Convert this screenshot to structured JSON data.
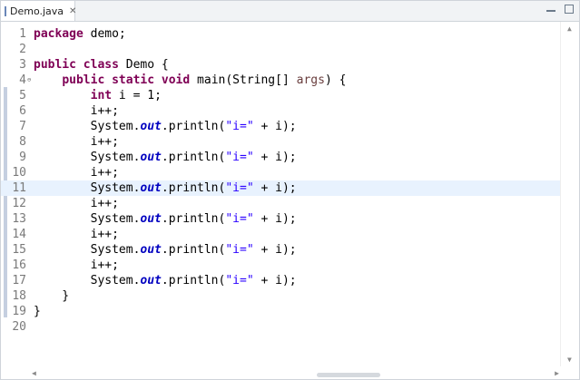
{
  "tab": {
    "label": "Demo.java",
    "close": "✕"
  },
  "editor": {
    "highlighted_line": 11,
    "lines": [
      {
        "n": "1",
        "code": [
          {
            "t": "package",
            "c": "kw"
          },
          {
            "t": " demo;"
          }
        ]
      },
      {
        "n": "2",
        "code": []
      },
      {
        "n": "3",
        "code": [
          {
            "t": "public",
            "c": "kw"
          },
          {
            "t": " "
          },
          {
            "t": "class",
            "c": "kw"
          },
          {
            "t": " Demo {"
          }
        ]
      },
      {
        "n": "4",
        "fold": "⊖",
        "code": [
          {
            "t": "    "
          },
          {
            "t": "public",
            "c": "kw"
          },
          {
            "t": " "
          },
          {
            "t": "static",
            "c": "kw"
          },
          {
            "t": " "
          },
          {
            "t": "void",
            "c": "kw"
          },
          {
            "t": " main(String[] "
          },
          {
            "t": "args",
            "c": "arg"
          },
          {
            "t": ") {"
          }
        ]
      },
      {
        "n": "5",
        "code": [
          {
            "t": "        "
          },
          {
            "t": "int",
            "c": "kw"
          },
          {
            "t": " i = 1;"
          }
        ]
      },
      {
        "n": "6",
        "code": [
          {
            "t": "        i++;"
          }
        ]
      },
      {
        "n": "7",
        "code": [
          {
            "t": "        System."
          },
          {
            "t": "out",
            "c": "fld"
          },
          {
            "t": ".println("
          },
          {
            "t": "\"i=\"",
            "c": "str"
          },
          {
            "t": " + i);"
          }
        ]
      },
      {
        "n": "8",
        "code": [
          {
            "t": "        i++;"
          }
        ]
      },
      {
        "n": "9",
        "code": [
          {
            "t": "        System."
          },
          {
            "t": "out",
            "c": "fld"
          },
          {
            "t": ".println("
          },
          {
            "t": "\"i=\"",
            "c": "str"
          },
          {
            "t": " + i);"
          }
        ]
      },
      {
        "n": "10",
        "code": [
          {
            "t": "        i++;"
          }
        ]
      },
      {
        "n": "11",
        "code": [
          {
            "t": "        System."
          },
          {
            "t": "out",
            "c": "fld"
          },
          {
            "t": ".println("
          },
          {
            "t": "\"i=\"",
            "c": "str"
          },
          {
            "t": " + i);"
          }
        ]
      },
      {
        "n": "12",
        "code": [
          {
            "t": "        i++;"
          }
        ]
      },
      {
        "n": "13",
        "code": [
          {
            "t": "        System."
          },
          {
            "t": "out",
            "c": "fld"
          },
          {
            "t": ".println("
          },
          {
            "t": "\"i=\"",
            "c": "str"
          },
          {
            "t": " + i);"
          }
        ]
      },
      {
        "n": "14",
        "code": [
          {
            "t": "        i++;"
          }
        ]
      },
      {
        "n": "15",
        "code": [
          {
            "t": "        System."
          },
          {
            "t": "out",
            "c": "fld"
          },
          {
            "t": ".println("
          },
          {
            "t": "\"i=\"",
            "c": "str"
          },
          {
            "t": " + i);"
          }
        ]
      },
      {
        "n": "16",
        "code": [
          {
            "t": "        i++;"
          }
        ]
      },
      {
        "n": "17",
        "code": [
          {
            "t": "        System."
          },
          {
            "t": "out",
            "c": "fld"
          },
          {
            "t": ".println("
          },
          {
            "t": "\"i=\"",
            "c": "str"
          },
          {
            "t": " + i);"
          }
        ]
      },
      {
        "n": "18",
        "code": [
          {
            "t": "    }"
          }
        ]
      },
      {
        "n": "19",
        "code": [
          {
            "t": "}"
          }
        ]
      },
      {
        "n": "20",
        "code": []
      }
    ]
  },
  "scroll": {
    "up": "▲",
    "down": "▼",
    "left": "◀",
    "right": "▶"
  },
  "icons": {
    "tab": "java-file-icon",
    "close": "close-icon",
    "minimize": "minimize-icon",
    "maximize": "maximize-icon"
  }
}
